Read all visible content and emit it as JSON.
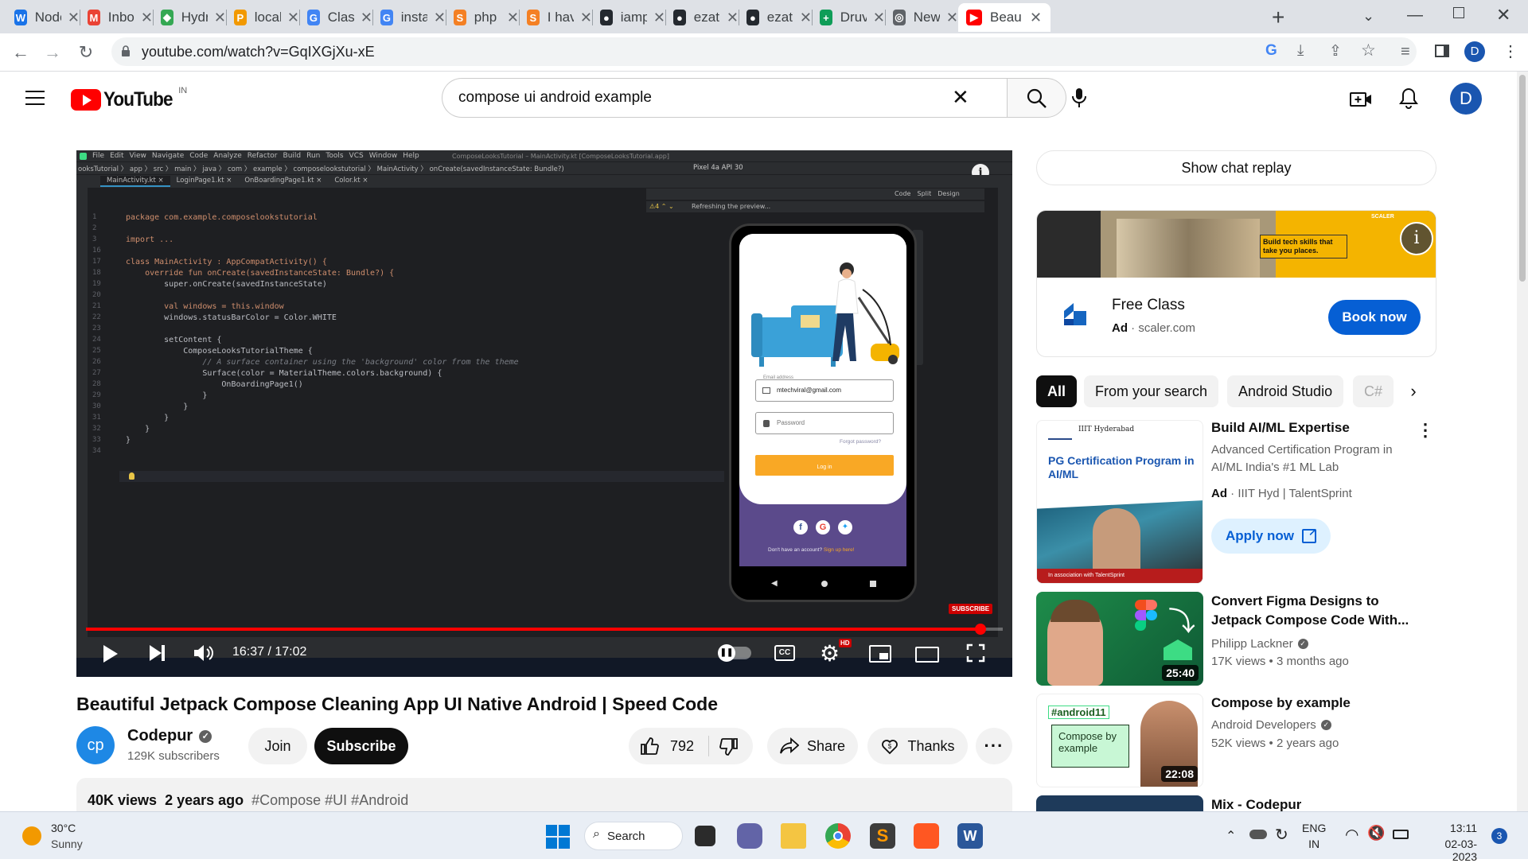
{
  "browser": {
    "tabs": [
      {
        "title": "Node",
        "fav_text": "W",
        "fav_color": "#1a73e8"
      },
      {
        "title": "Inbox",
        "fav_text": "M",
        "fav_color": "#ea4335"
      },
      {
        "title": "Hydr",
        "fav_text": "◆",
        "fav_color": "#34a853"
      },
      {
        "title": "local",
        "fav_text": "P",
        "fav_color": "#f29900"
      },
      {
        "title": "Class",
        "fav_text": "G",
        "fav_color": "#4285f4"
      },
      {
        "title": "insta",
        "fav_text": "G",
        "fav_color": "#4285f4"
      },
      {
        "title": "php",
        "fav_text": "S",
        "fav_color": "#f48024"
      },
      {
        "title": "I hav",
        "fav_text": "S",
        "fav_color": "#f48024"
      },
      {
        "title": "iamp",
        "fav_text": "●",
        "fav_color": "#24292f"
      },
      {
        "title": "ezat",
        "fav_text": "●",
        "fav_color": "#24292f"
      },
      {
        "title": "ezat",
        "fav_text": "●",
        "fav_color": "#24292f"
      },
      {
        "title": "Druv",
        "fav_text": "+",
        "fav_color": "#0f9d58"
      },
      {
        "title": "New",
        "fav_text": "◎",
        "fav_color": "#5f6368"
      },
      {
        "title": "Beau",
        "fav_text": "▶",
        "fav_color": "#ff0000"
      }
    ],
    "new_tab": "+",
    "url": "youtube.com/watch?v=GqIXGjXu-xE",
    "profile_initial": "D"
  },
  "yt": {
    "logo_text": "YouTube",
    "region": "IN",
    "search_query": "compose ui android example",
    "avatar_initial": "D"
  },
  "video": {
    "time": "16:37 / 17:02",
    "progress": 0.976,
    "hd_badge": "HD",
    "subscribe_badge": "SUBSCRIBE",
    "title": "Beautiful Jetpack Compose Cleaning App UI Native Android | Speed Code",
    "channel": "Codepur",
    "channel_avatar": "cp",
    "subscribers": "129K subscribers",
    "join": "Join",
    "subscribe": "Subscribe",
    "likes": "792",
    "share": "Share",
    "thanks": "Thanks",
    "views": "40K views",
    "age": "2 years ago",
    "hashtags": "#Compose #UI #Android"
  },
  "ide": {
    "menu": [
      "File",
      "Edit",
      "View",
      "Navigate",
      "Code",
      "Analyze",
      "Refactor",
      "Build",
      "Run",
      "Tools",
      "VCS",
      "Window",
      "Help"
    ],
    "window_title": "ComposeLooksTutorial – MainActivity.kt [ComposeLooksTutorial.app]",
    "breadcrumb": "ooksTutorial 〉 app 〉 src 〉 main 〉 java 〉 com 〉 example 〉 composelookstutorial 〉 MainActivity 〉 onCreate(savedInstanceState: Bundle?)",
    "device": "Pixel 4a API 30",
    "file_tabs": [
      "MainActivity.kt",
      "LoginPage1.kt",
      "OnBoardingPage1.kt",
      "Color.kt"
    ],
    "refreshing": "Refreshing the preview...",
    "line_numbers": [
      "1",
      "2",
      "3",
      "16",
      "17",
      "18",
      "19",
      "20",
      "21",
      "22",
      "23",
      "24",
      "25",
      "26",
      "27",
      "28",
      "29",
      "30",
      "31",
      "32",
      "33",
      "34"
    ],
    "code_lines": [
      "package com.example.composelookstutorial",
      "",
      "import ...",
      "",
      "class MainActivity : AppCompatActivity() {",
      "    override fun onCreate(savedInstanceState: Bundle?) {",
      "        super.onCreate(savedInstanceState)",
      "",
      "        val windows = this.window",
      "        windows.statusBarColor = Color.WHITE",
      "",
      "        setContent {",
      "            ComposeLooksTutorialTheme {",
      "                // A surface container using the 'background' color from the theme",
      "                Surface(color = MaterialTheme.colors.background) {",
      "                    OnBoardingPage1()",
      "                }",
      "            }",
      "        }",
      "    }",
      "}"
    ],
    "preview_tabs": [
      "Code",
      "Split",
      "Design"
    ],
    "phone_email_label": "Email address",
    "phone_email": "mtechviral@gmail.com",
    "phone_password": "Password",
    "phone_forgot": "Forgot password?",
    "phone_login": "Log in",
    "phone_signup_text": "Don't have an account? ",
    "phone_signup_link": "Sign up here!"
  },
  "sidebar": {
    "chat_replay": "Show chat replay",
    "ad1": {
      "banner_text": "Build tech skills that take you places.",
      "brand": "SCALER",
      "title": "Free Class",
      "ad_label": "Ad",
      "domain": "scaler.com",
      "cta": "Book now"
    },
    "chips": [
      "All",
      "From your search",
      "Android Studio",
      "C#"
    ],
    "ad2": {
      "thumb_org": "IIIT Hyderabad",
      "thumb_title": "PG Certification Program in AI/ML",
      "thumb_caption": "In association with TalentSprint",
      "title": "Build AI/ML Expertise",
      "desc1": "Advanced Certification Program in",
      "desc2": "AI/ML India's #1 ML Lab",
      "ad_label": "Ad",
      "advertiser": "IIIT Hyd | TalentSprint",
      "cta": "Apply now"
    },
    "videos": [
      {
        "title1": "Convert Figma Designs to",
        "title2": "Jetpack Compose Code With...",
        "channel": "Philipp Lackner",
        "meta": "17K views • 3 months ago",
        "duration": "25:40"
      },
      {
        "title1": "Compose by example",
        "title2": "",
        "channel": "Android Developers",
        "meta": "52K views • 2 years ago",
        "duration": "22:08",
        "thumb_tag": "#android11",
        "thumb_text": "Compose by example"
      },
      {
        "title1": "Mix - Codepur",
        "title2": "",
        "channel": "",
        "meta": "",
        "duration": ""
      }
    ]
  },
  "taskbar": {
    "temp": "30°C",
    "weather": "Sunny",
    "search": "Search",
    "lang1": "ENG",
    "lang2": "IN",
    "time": "13:11",
    "date": "02-03-2023",
    "notif_count": "3"
  }
}
